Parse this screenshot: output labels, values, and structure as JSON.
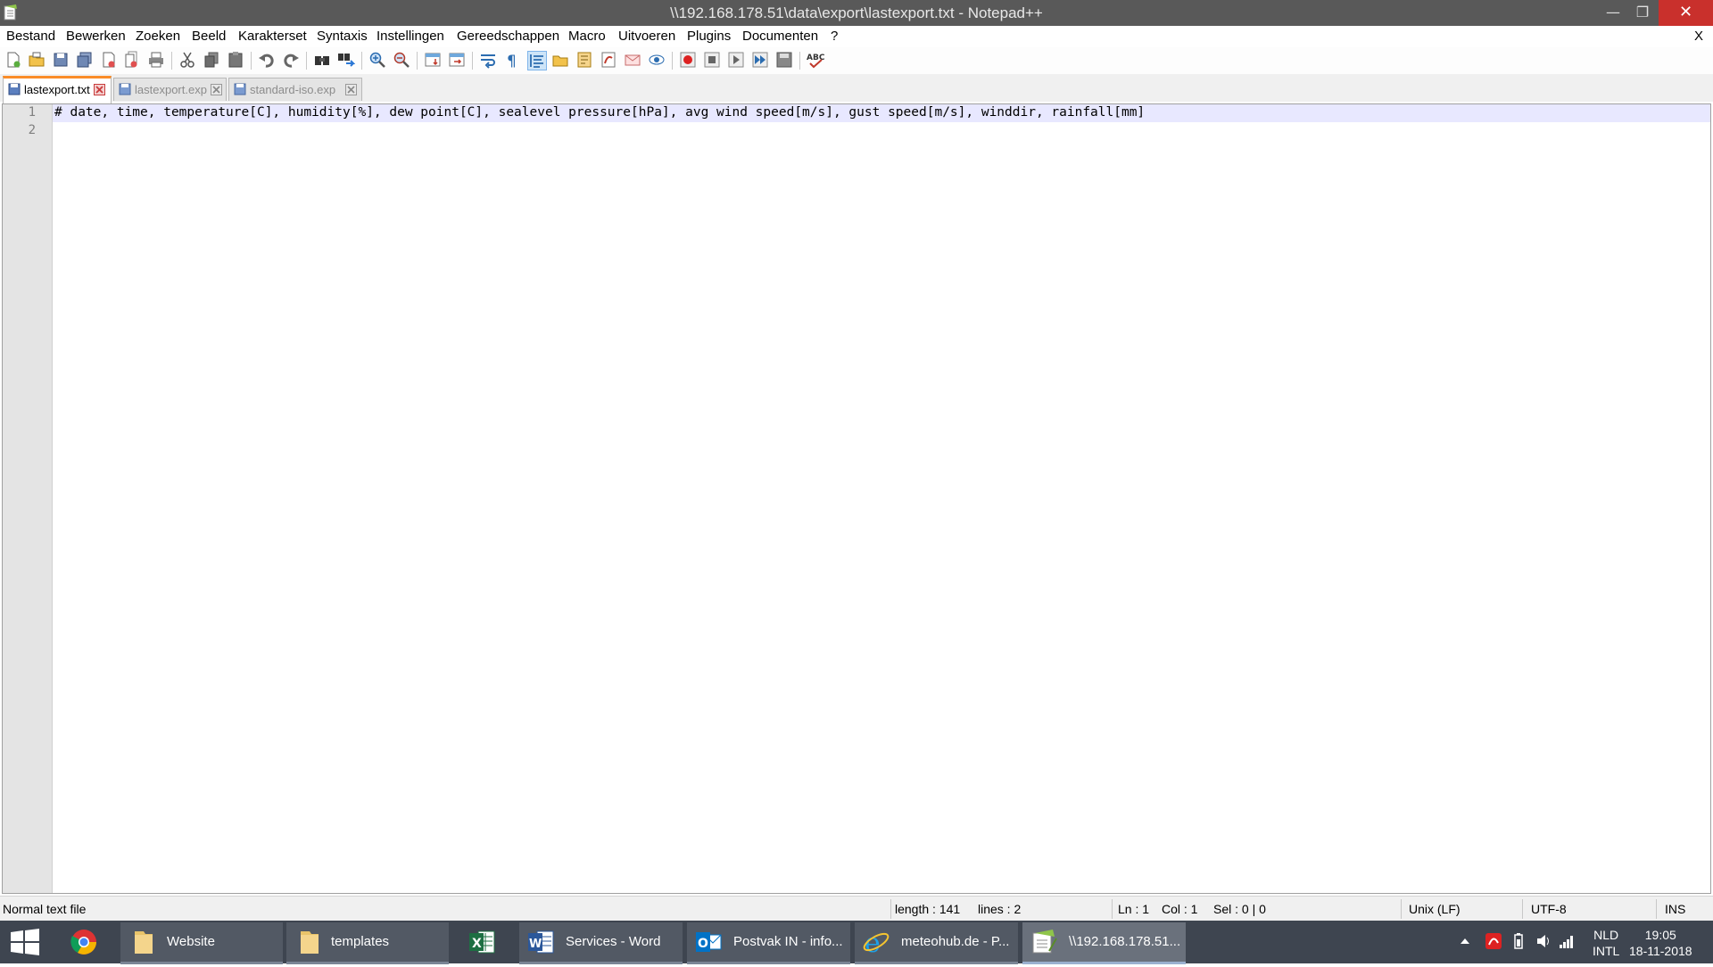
{
  "window": {
    "title": "\\\\192.168.178.51\\data\\export\\lastexport.txt - Notepad++",
    "minimize": "—",
    "maximize": "❐",
    "close": "✕"
  },
  "menu": {
    "items": [
      "Bestand",
      "Bewerken",
      "Zoeken",
      "Beeld",
      "Karakterset",
      "Syntaxis",
      "Instellingen",
      "Gereedschappen",
      "Macro",
      "Uitvoeren",
      "Plugins",
      "Documenten",
      "?"
    ],
    "close_doc": "X"
  },
  "toolbar": {
    "icons": [
      "new-file-icon",
      "open-file-icon",
      "save-icon",
      "save-all-icon",
      "close-icon",
      "close-all-icon",
      "print-icon",
      "cut-icon",
      "copy-icon",
      "paste-icon",
      "undo-icon",
      "redo-icon",
      "find-icon",
      "replace-icon",
      "zoom-in-icon",
      "zoom-out-icon",
      "sync-vertical-icon",
      "sync-horizontal-icon",
      "word-wrap-icon",
      "show-all-chars-icon",
      "indent-guide-icon",
      "doc-map-icon",
      "function-list-icon",
      "folder-as-workspace-icon",
      "monitor-icon",
      "macro-record-icon",
      "macro-stop-icon",
      "macro-play-icon",
      "macro-run-multiple-icon",
      "macro-save-icon",
      "spellcheck-icon"
    ]
  },
  "tabs": [
    {
      "label": "lastexport.txt",
      "active": true
    },
    {
      "label": "lastexport.exp",
      "active": false
    },
    {
      "label": "standard-iso.exp",
      "active": false
    }
  ],
  "editor": {
    "lines": [
      {
        "number": "1",
        "text": "# date, time, temperature[C], humidity[%], dew point[C], sealevel pressure[hPa], avg wind speed[m/s], gust speed[m/s], winddir, rainfall[mm]"
      },
      {
        "number": "2",
        "text": ""
      }
    ]
  },
  "status": {
    "file_type": "Normal text file",
    "length": "length : 141",
    "lines": "lines : 2",
    "ln": "Ln : 1",
    "col": "Col : 1",
    "sel": "Sel : 0 | 0",
    "eol": "Unix (LF)",
    "encoding": "UTF-8",
    "mode": "INS"
  },
  "taskbar": {
    "items": [
      {
        "label": "",
        "icon": "chrome-icon"
      },
      {
        "label": "Website",
        "icon": "folder-icon"
      },
      {
        "label": "templates",
        "icon": "folder-icon"
      },
      {
        "label": "",
        "icon": "excel-icon"
      },
      {
        "label": "Services - Word",
        "icon": "word-icon"
      },
      {
        "label": "Postvak IN - info...",
        "icon": "outlook-icon"
      },
      {
        "label": "meteohub.de - P...",
        "icon": "ie-icon"
      },
      {
        "label": "\\\\192.168.178.51...",
        "icon": "notepadpp-icon"
      }
    ],
    "lang_top": "NLD",
    "lang_bottom": "INTL",
    "time": "19:05",
    "date": "18-11-2018"
  },
  "colors": {
    "titlebar": "#595959",
    "close_button": "#c9302c",
    "active_tab_accent": "#fa8c28",
    "current_line": "#e8e8ff",
    "taskbar": "#3e4550"
  }
}
